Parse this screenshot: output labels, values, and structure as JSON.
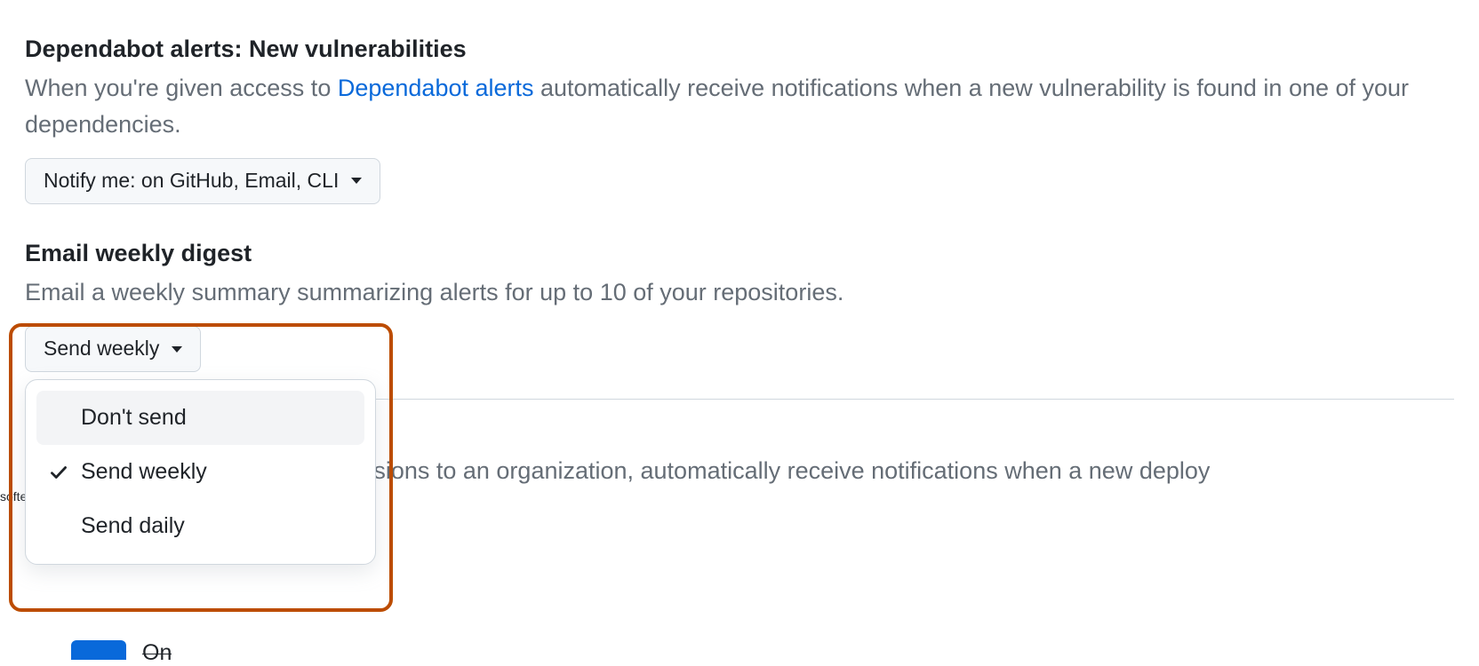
{
  "dependabot": {
    "title": "Dependabot alerts: New vulnerabilities",
    "desc_prefix": "When you're given access to ",
    "desc_link": "Dependabot alerts",
    "desc_suffix": " automatically receive notifications when a new vulnerability is found in one of your dependencies.",
    "notify_button": "Notify me: on GitHub, Email, CLI"
  },
  "digest": {
    "title": "Email weekly digest",
    "desc": "Email a weekly summary summarizing alerts for up to 10 of your repositories.",
    "button_label": "Send weekly",
    "options": [
      {
        "label": "Don't send",
        "selected": false
      },
      {
        "label": "Send weekly",
        "selected": true
      },
      {
        "label": "Send daily",
        "selected": false
      }
    ]
  },
  "below": {
    "partial_desc": "missions to an organization, automatically receive notifications when a new deploy",
    "toggle_label": "On"
  }
}
